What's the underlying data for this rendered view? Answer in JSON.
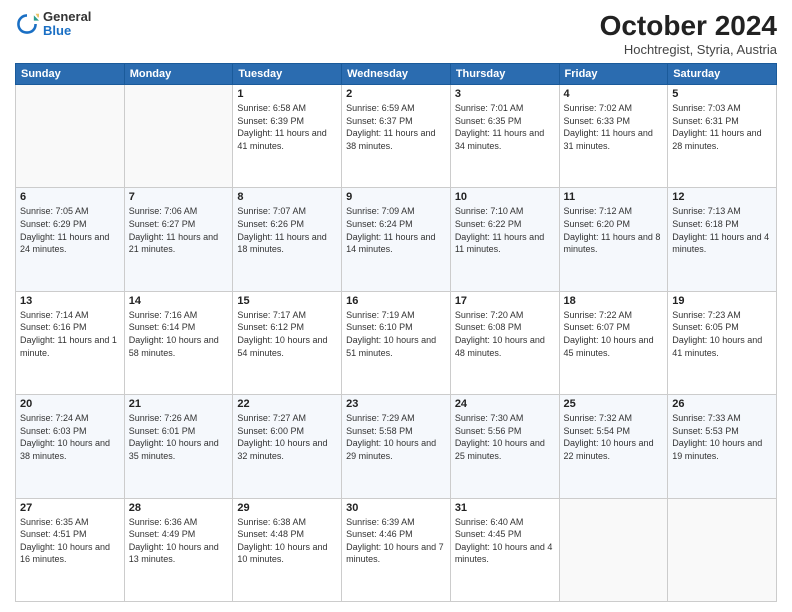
{
  "logo": {
    "general": "General",
    "blue": "Blue"
  },
  "header": {
    "month": "October 2024",
    "location": "Hochtregist, Styria, Austria"
  },
  "days_of_week": [
    "Sunday",
    "Monday",
    "Tuesday",
    "Wednesday",
    "Thursday",
    "Friday",
    "Saturday"
  ],
  "weeks": [
    [
      {
        "day": "",
        "info": ""
      },
      {
        "day": "",
        "info": ""
      },
      {
        "day": "1",
        "info": "Sunrise: 6:58 AM\nSunset: 6:39 PM\nDaylight: 11 hours and 41 minutes."
      },
      {
        "day": "2",
        "info": "Sunrise: 6:59 AM\nSunset: 6:37 PM\nDaylight: 11 hours and 38 minutes."
      },
      {
        "day": "3",
        "info": "Sunrise: 7:01 AM\nSunset: 6:35 PM\nDaylight: 11 hours and 34 minutes."
      },
      {
        "day": "4",
        "info": "Sunrise: 7:02 AM\nSunset: 6:33 PM\nDaylight: 11 hours and 31 minutes."
      },
      {
        "day": "5",
        "info": "Sunrise: 7:03 AM\nSunset: 6:31 PM\nDaylight: 11 hours and 28 minutes."
      }
    ],
    [
      {
        "day": "6",
        "info": "Sunrise: 7:05 AM\nSunset: 6:29 PM\nDaylight: 11 hours and 24 minutes."
      },
      {
        "day": "7",
        "info": "Sunrise: 7:06 AM\nSunset: 6:27 PM\nDaylight: 11 hours and 21 minutes."
      },
      {
        "day": "8",
        "info": "Sunrise: 7:07 AM\nSunset: 6:26 PM\nDaylight: 11 hours and 18 minutes."
      },
      {
        "day": "9",
        "info": "Sunrise: 7:09 AM\nSunset: 6:24 PM\nDaylight: 11 hours and 14 minutes."
      },
      {
        "day": "10",
        "info": "Sunrise: 7:10 AM\nSunset: 6:22 PM\nDaylight: 11 hours and 11 minutes."
      },
      {
        "day": "11",
        "info": "Sunrise: 7:12 AM\nSunset: 6:20 PM\nDaylight: 11 hours and 8 minutes."
      },
      {
        "day": "12",
        "info": "Sunrise: 7:13 AM\nSunset: 6:18 PM\nDaylight: 11 hours and 4 minutes."
      }
    ],
    [
      {
        "day": "13",
        "info": "Sunrise: 7:14 AM\nSunset: 6:16 PM\nDaylight: 11 hours and 1 minute."
      },
      {
        "day": "14",
        "info": "Sunrise: 7:16 AM\nSunset: 6:14 PM\nDaylight: 10 hours and 58 minutes."
      },
      {
        "day": "15",
        "info": "Sunrise: 7:17 AM\nSunset: 6:12 PM\nDaylight: 10 hours and 54 minutes."
      },
      {
        "day": "16",
        "info": "Sunrise: 7:19 AM\nSunset: 6:10 PM\nDaylight: 10 hours and 51 minutes."
      },
      {
        "day": "17",
        "info": "Sunrise: 7:20 AM\nSunset: 6:08 PM\nDaylight: 10 hours and 48 minutes."
      },
      {
        "day": "18",
        "info": "Sunrise: 7:22 AM\nSunset: 6:07 PM\nDaylight: 10 hours and 45 minutes."
      },
      {
        "day": "19",
        "info": "Sunrise: 7:23 AM\nSunset: 6:05 PM\nDaylight: 10 hours and 41 minutes."
      }
    ],
    [
      {
        "day": "20",
        "info": "Sunrise: 7:24 AM\nSunset: 6:03 PM\nDaylight: 10 hours and 38 minutes."
      },
      {
        "day": "21",
        "info": "Sunrise: 7:26 AM\nSunset: 6:01 PM\nDaylight: 10 hours and 35 minutes."
      },
      {
        "day": "22",
        "info": "Sunrise: 7:27 AM\nSunset: 6:00 PM\nDaylight: 10 hours and 32 minutes."
      },
      {
        "day": "23",
        "info": "Sunrise: 7:29 AM\nSunset: 5:58 PM\nDaylight: 10 hours and 29 minutes."
      },
      {
        "day": "24",
        "info": "Sunrise: 7:30 AM\nSunset: 5:56 PM\nDaylight: 10 hours and 25 minutes."
      },
      {
        "day": "25",
        "info": "Sunrise: 7:32 AM\nSunset: 5:54 PM\nDaylight: 10 hours and 22 minutes."
      },
      {
        "day": "26",
        "info": "Sunrise: 7:33 AM\nSunset: 5:53 PM\nDaylight: 10 hours and 19 minutes."
      }
    ],
    [
      {
        "day": "27",
        "info": "Sunrise: 6:35 AM\nSunset: 4:51 PM\nDaylight: 10 hours and 16 minutes."
      },
      {
        "day": "28",
        "info": "Sunrise: 6:36 AM\nSunset: 4:49 PM\nDaylight: 10 hours and 13 minutes."
      },
      {
        "day": "29",
        "info": "Sunrise: 6:38 AM\nSunset: 4:48 PM\nDaylight: 10 hours and 10 minutes."
      },
      {
        "day": "30",
        "info": "Sunrise: 6:39 AM\nSunset: 4:46 PM\nDaylight: 10 hours and 7 minutes."
      },
      {
        "day": "31",
        "info": "Sunrise: 6:40 AM\nSunset: 4:45 PM\nDaylight: 10 hours and 4 minutes."
      },
      {
        "day": "",
        "info": ""
      },
      {
        "day": "",
        "info": ""
      }
    ]
  ]
}
